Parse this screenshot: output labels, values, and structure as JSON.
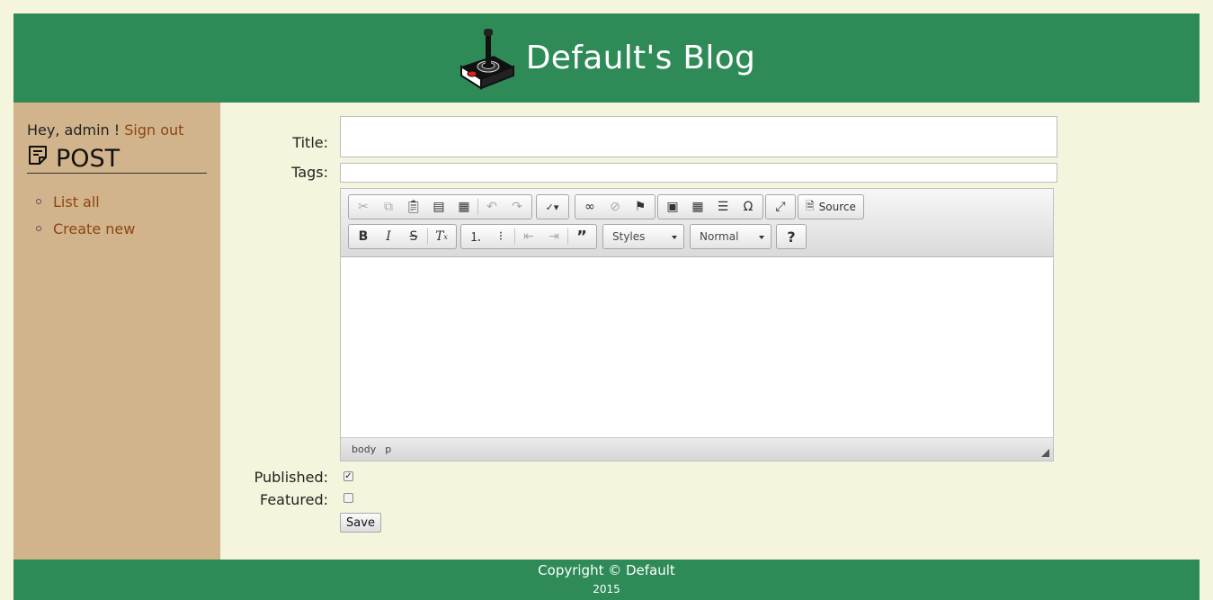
{
  "header": {
    "title": "Default's Blog",
    "logo_icon": "joystick-icon"
  },
  "sidebar": {
    "greeting": "Hey, admin !",
    "signout_label": "Sign out",
    "section_title": "POST",
    "section_icon": "note-icon",
    "links": [
      {
        "label": "List all"
      },
      {
        "label": "Create new"
      }
    ]
  },
  "form": {
    "title_label": "Title:",
    "title_value": "",
    "tags_label": "Tags:",
    "tags_value": "",
    "published_label": "Published:",
    "published_checked": true,
    "featured_label": "Featured:",
    "featured_checked": false,
    "save_label": "Save"
  },
  "editor": {
    "toolbar_row1": [
      "cut-icon",
      "copy-icon",
      "paste-icon",
      "paste-text-icon",
      "paste-word-icon",
      "undo-icon",
      "redo-icon",
      "spellcheck-icon",
      "link-icon",
      "unlink-icon",
      "anchor-icon",
      "image-icon",
      "table-icon",
      "horizontal-rule-icon",
      "special-char-icon",
      "maximize-icon"
    ],
    "source_label": "Source",
    "toolbar_row2": [
      "bold-icon",
      "italic-icon",
      "strike-icon",
      "remove-format-icon",
      "numbered-list-icon",
      "bulleted-list-icon",
      "outdent-icon",
      "indent-icon",
      "blockquote-icon",
      "help-icon"
    ],
    "styles_label": "Styles",
    "format_label": "Normal",
    "path": [
      "body",
      "p"
    ]
  },
  "footer": {
    "copyright": "Copyright © Default",
    "year": "2015"
  },
  "colors": {
    "header_bg": "#2e8b57",
    "sidebar_bg": "#d2b48c",
    "page_bg": "#f5f4dc",
    "link": "#8b4513"
  }
}
